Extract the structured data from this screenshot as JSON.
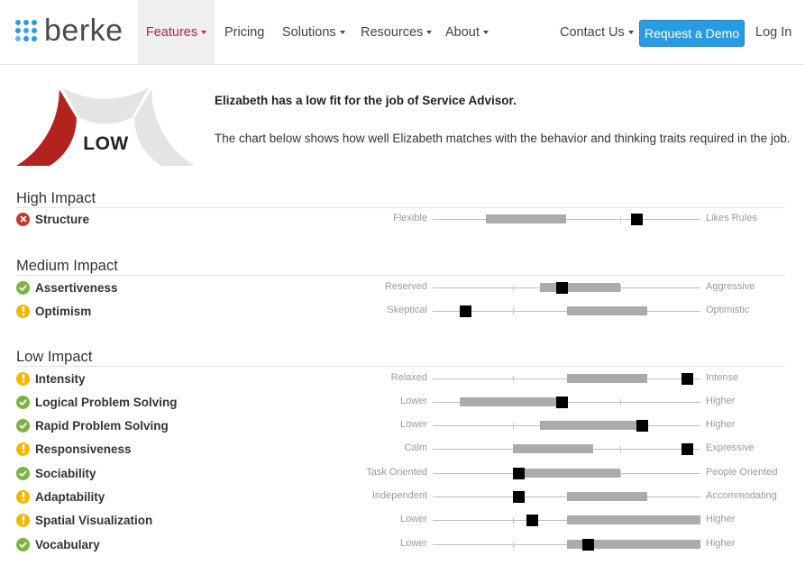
{
  "nav": {
    "brand": "berke",
    "items": [
      {
        "label": "Features",
        "dropdown": true,
        "active": true
      },
      {
        "label": "Pricing",
        "dropdown": false,
        "active": false
      },
      {
        "label": "Solutions",
        "dropdown": true,
        "active": false
      },
      {
        "label": "Resources",
        "dropdown": true,
        "active": false
      },
      {
        "label": "About",
        "dropdown": true,
        "active": false
      }
    ],
    "contact": "Contact Us",
    "demo_button": "Request a Demo",
    "login": "Log In"
  },
  "fit": {
    "level": "LOW",
    "level_fraction": 0.33,
    "summary_title": "Elizabeth has a low fit for the job of Service Advisor.",
    "summary_text": "The chart below shows how well Elizabeth matches with the behavior and thinking traits required in the job."
  },
  "colors": {
    "accent": "#b8234a",
    "button": "#2a9be2",
    "gauge_low": "#b2231d",
    "gauge_track": "#e4e4e4",
    "ok": "#7cb342",
    "warn": "#f5b800",
    "bad": "#c0392b"
  },
  "sections": [
    {
      "title": "High Impact",
      "traits": [
        {
          "name": "Structure",
          "status": "bad",
          "icon": "x-circle-icon",
          "left": "Flexible",
          "right": "Likes Rules"
        }
      ]
    },
    {
      "title": "Medium Impact",
      "traits": [
        {
          "name": "Assertiveness",
          "status": "ok",
          "icon": "check-circle-icon",
          "left": "Reserved",
          "right": "Aggressive"
        },
        {
          "name": "Optimism",
          "status": "warn",
          "icon": "exclamation-circle-icon",
          "left": "Skeptical",
          "right": "Optimistic"
        }
      ]
    },
    {
      "title": "Low Impact",
      "traits": [
        {
          "name": "Intensity",
          "status": "warn",
          "icon": "exclamation-circle-icon",
          "left": "Relaxed",
          "right": "Intense"
        },
        {
          "name": "Logical Problem Solving",
          "status": "ok",
          "icon": "check-circle-icon",
          "left": "Lower",
          "right": "Higher"
        },
        {
          "name": "Rapid Problem Solving",
          "status": "ok",
          "icon": "check-circle-icon",
          "left": "Lower",
          "right": "Higher"
        },
        {
          "name": "Responsiveness",
          "status": "warn",
          "icon": "exclamation-circle-icon",
          "left": "Calm",
          "right": "Expressive"
        },
        {
          "name": "Sociability",
          "status": "ok",
          "icon": "check-circle-icon",
          "left": "Task Oriented",
          "right": "People Oriented"
        },
        {
          "name": "Adaptability",
          "status": "warn",
          "icon": "exclamation-circle-icon",
          "left": "Independent",
          "right": "Accommodating"
        },
        {
          "name": "Spatial Visualization",
          "status": "warn",
          "icon": "exclamation-circle-icon",
          "left": "Lower",
          "right": "Higher"
        },
        {
          "name": "Vocabulary",
          "status": "ok",
          "icon": "check-circle-icon",
          "left": "Lower",
          "right": "Higher"
        }
      ]
    }
  ],
  "chart_data": {
    "type": "range",
    "scale": [
      0,
      1
    ],
    "rows": [
      {
        "trait": "Structure",
        "range": [
          0.2,
          0.5
        ],
        "score": 0.76
      },
      {
        "trait": "Assertiveness",
        "range": [
          0.4,
          0.7
        ],
        "score": 0.48
      },
      {
        "trait": "Optimism",
        "range": [
          0.5,
          0.8
        ],
        "score": 0.12
      },
      {
        "trait": "Intensity",
        "range": [
          0.5,
          0.8
        ],
        "score": 0.95
      },
      {
        "trait": "Logical Problem Solving",
        "range": [
          0.1,
          0.5
        ],
        "score": 0.48
      },
      {
        "trait": "Rapid Problem Solving",
        "range": [
          0.4,
          0.8
        ],
        "score": 0.78
      },
      {
        "trait": "Responsiveness",
        "range": [
          0.3,
          0.6
        ],
        "score": 0.95
      },
      {
        "trait": "Sociability",
        "range": [
          0.3,
          0.7
        ],
        "score": 0.32
      },
      {
        "trait": "Adaptability",
        "range": [
          0.5,
          0.8
        ],
        "score": 0.32
      },
      {
        "trait": "Spatial Visualization",
        "range": [
          0.5,
          1.0
        ],
        "score": 0.37
      },
      {
        "trait": "Vocabulary",
        "range": [
          0.5,
          1.0
        ],
        "score": 0.58
      }
    ]
  }
}
